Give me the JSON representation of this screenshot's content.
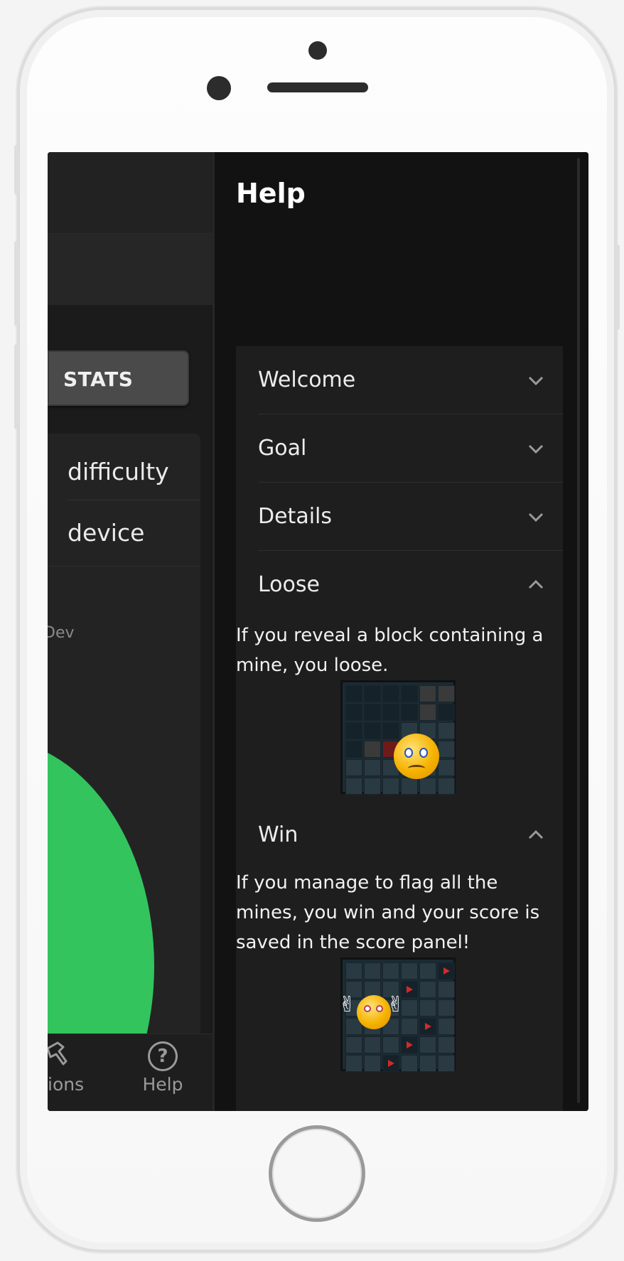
{
  "left_app": {
    "stats_button": "STATS",
    "list_items": [
      "difficulty",
      "device"
    ],
    "dev_text": "Dev",
    "bottom_tabs": {
      "options_partial": "ions",
      "help": "Help"
    },
    "accent_color": "#33c45e"
  },
  "help_panel": {
    "title": "Help",
    "sections": [
      {
        "title": "Welcome",
        "expanded": false
      },
      {
        "title": "Goal",
        "expanded": false
      },
      {
        "title": "Details",
        "expanded": false
      },
      {
        "title": "Loose",
        "expanded": true,
        "text": "If you reveal a block containing a mine, you loose."
      },
      {
        "title": "Win",
        "expanded": true,
        "text": "If you manage to flag all the mines, you win and your score is saved in the score panel!"
      }
    ]
  }
}
